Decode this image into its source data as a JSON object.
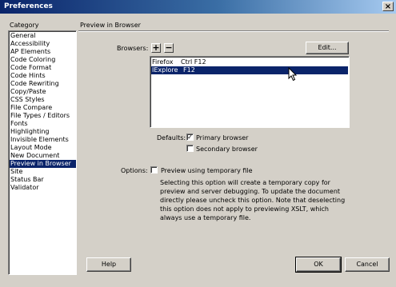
{
  "window": {
    "title": "Preferences",
    "close_glyph": "×"
  },
  "category": {
    "heading": "Category",
    "items": [
      "General",
      "Accessibility",
      "AP Elements",
      "Code Coloring",
      "Code Format",
      "Code Hints",
      "Code Rewriting",
      "Copy/Paste",
      "CSS Styles",
      "File Compare",
      "File Types / Editors",
      "Fonts",
      "Highlighting",
      "Invisible Elements",
      "Layout Mode",
      "New Document",
      "Preview in Browser",
      "Site",
      "Status Bar",
      "Validator"
    ],
    "selected": "Preview in Browser"
  },
  "panel": {
    "title": "Preview in Browser",
    "browsers_label": "Browsers:",
    "add_glyph": "+",
    "remove_glyph": "−",
    "edit_label": "Edit...",
    "browsers": [
      {
        "name": "Firefox",
        "key": "Ctrl F12",
        "selected": false
      },
      {
        "name": "IExplore",
        "key": "F12",
        "selected": true
      }
    ],
    "defaults_label": "Defaults:",
    "primary_label": "Primary browser",
    "primary_checked": true,
    "secondary_label": "Secondary browser",
    "secondary_checked": false,
    "options_label": "Options:",
    "temp_label": "Preview using temporary file",
    "temp_checked": false,
    "description": "Selecting this option will create a temporary copy for preview and server debugging. To update the document directly please uncheck this option. Note that deselecting this option does not apply to previewing XSLT, which always use a temporary file."
  },
  "footer": {
    "help_label": "Help",
    "ok_label": "OK",
    "cancel_label": "Cancel"
  },
  "colors": {
    "selection": "#0a246a",
    "face": "#d4d0c8",
    "title_start": "#0a246a",
    "title_end": "#a6caf0"
  }
}
